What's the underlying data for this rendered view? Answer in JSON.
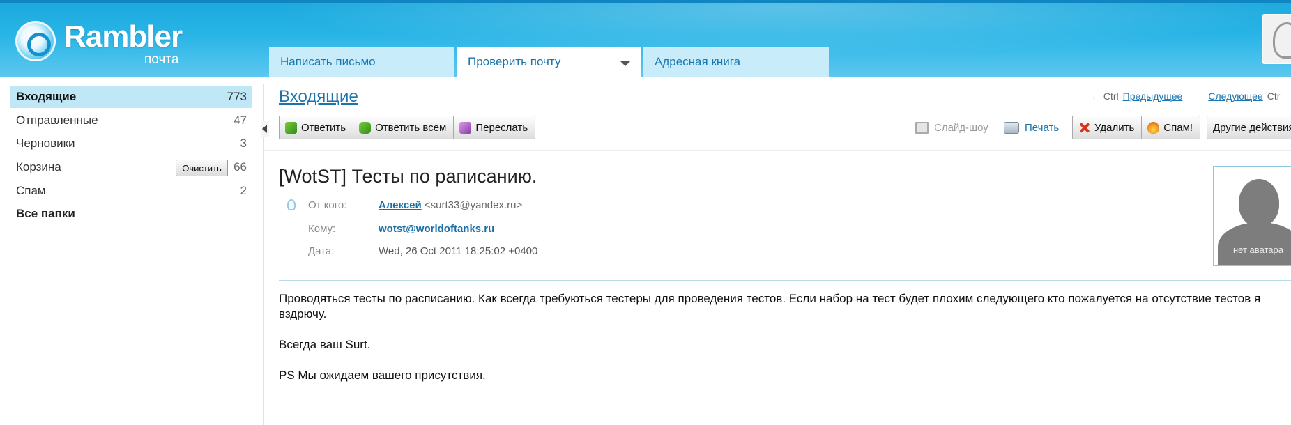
{
  "header": {
    "logo_text": "Rambler",
    "logo_sub": "почта",
    "tabs": [
      {
        "label": "Написать письмо"
      },
      {
        "label": "Проверить почту"
      },
      {
        "label": "Адресная книга"
      }
    ],
    "colors": {
      "header_blue": "#28b4e6",
      "tab_bg": "#c8ecfa",
      "link": "#1a74ad"
    }
  },
  "sidebar": {
    "folders": [
      {
        "label": "Входящие",
        "count": "773"
      },
      {
        "label": "Отправленные",
        "count": "47"
      },
      {
        "label": "Черновики",
        "count": "3"
      },
      {
        "label": "Корзина",
        "count": "66"
      },
      {
        "label": "Спам",
        "count": "2"
      },
      {
        "label": "Все папки",
        "count": ""
      }
    ],
    "clear_label": "Очистить"
  },
  "main": {
    "title": "Входящие",
    "nav": {
      "ctrl_prev": "← Ctrl",
      "prev_label": "Предыдущее",
      "next_label": "Следующее",
      "ctrl_next": "Ctr"
    },
    "toolbar": {
      "reply": "Ответить",
      "reply_all": "Ответить всем",
      "forward": "Переслать",
      "slideshow": "Слайд-шоу",
      "print": "Печать",
      "delete": "Удалить",
      "spam": "Спам!",
      "other_actions": "Другие действия"
    }
  },
  "message": {
    "subject": "[WotST] Тесты по раписанию.",
    "from_label": "От кого:",
    "from_name": "Алексей",
    "from_email": "<surt33@yandex.ru>",
    "to_label": "Кому:",
    "to_value": "wotst@worldoftanks.ru",
    "date_label": "Дата:",
    "date_value": "Wed, 26 Oct 2011 18:25:02 +0400",
    "avatar_caption": "нет аватара",
    "body": [
      "Проводяться тесты по расписанию. Как всегда требуються тестеры для проведения тестов. Если набор на тест будет плохим следующего кто пожалуется на отсутствие тестов я вздрючу.",
      "Всегда ваш Surt.",
      "PS Мы ожидаем вашего присутствия."
    ]
  }
}
